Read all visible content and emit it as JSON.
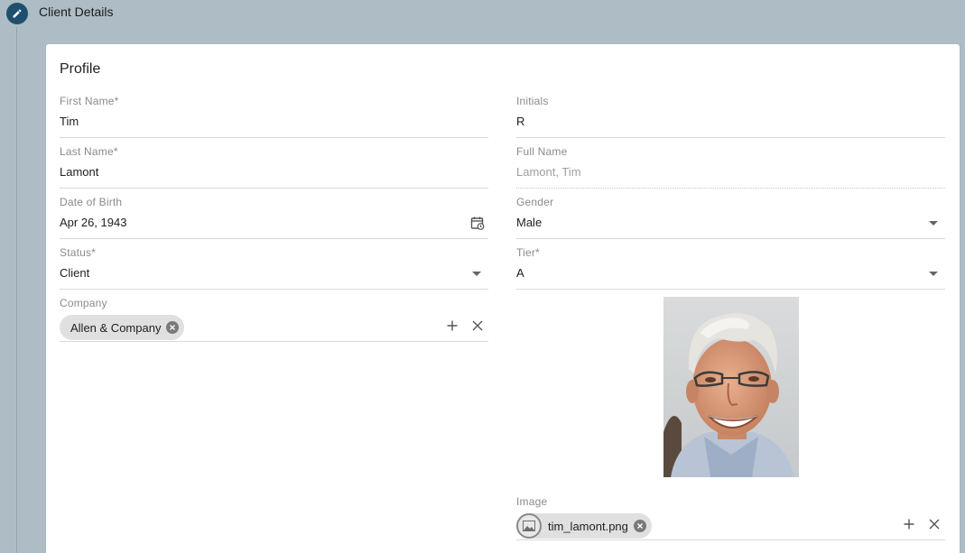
{
  "step": {
    "title": "Client Details",
    "icon": "pencil-icon"
  },
  "card": {
    "title": "Profile"
  },
  "fields": {
    "first_name": {
      "label": "First Name*",
      "value": "Tim"
    },
    "initials": {
      "label": "Initials",
      "value": "R"
    },
    "last_name": {
      "label": "Last Name*",
      "value": "Lamont"
    },
    "full_name": {
      "label": "Full Name",
      "value": "Lamont, Tim"
    },
    "dob": {
      "label": "Date of Birth",
      "value": "Apr 26, 1943",
      "icon": "calendar-icon"
    },
    "gender": {
      "label": "Gender",
      "value": "Male"
    },
    "status": {
      "label": "Status*",
      "value": "Client"
    },
    "tier": {
      "label": "Tier*",
      "value": "A"
    },
    "company": {
      "label": "Company",
      "chip": "Allen & Company"
    },
    "image": {
      "label": "Image",
      "chip": "tim_lamont.png"
    }
  },
  "colors": {
    "background": "#aebdc5",
    "accent": "#1e4f6e",
    "chip": "#e0e0e0"
  }
}
